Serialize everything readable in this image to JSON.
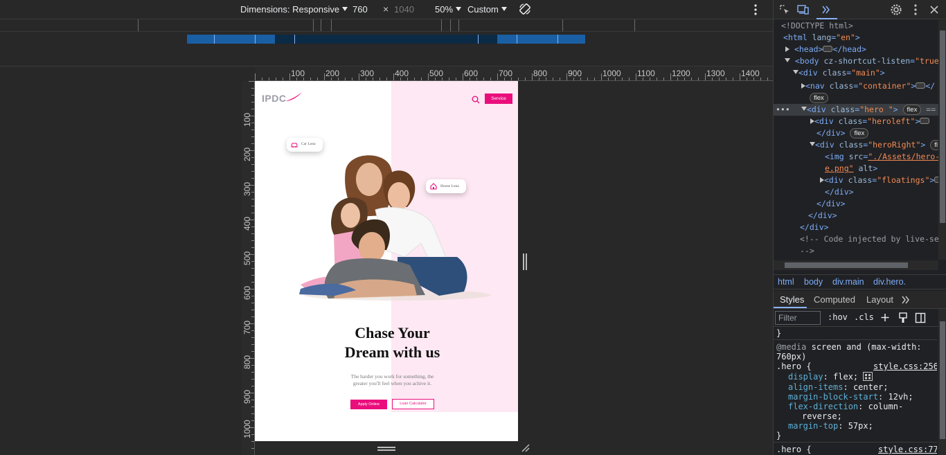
{
  "toolbar": {
    "dimensions_label": "Dimensions: Responsive",
    "width_value": "760",
    "times": "×",
    "height_value": "1040",
    "zoom_label": "50%",
    "throttle_label": "Custom"
  },
  "ruler_h": [
    "100",
    "200",
    "300",
    "400",
    "500",
    "600",
    "700",
    "800",
    "900",
    "1000",
    "1100",
    "1200",
    "1300",
    "1400"
  ],
  "ruler_v": [
    "100",
    "200",
    "300",
    "400",
    "500",
    "600",
    "700",
    "800",
    "900",
    "1000"
  ],
  "page": {
    "logo": "IPDC",
    "service_button": "Service",
    "badge_car": "Car Lona",
    "badge_house": "House Lona",
    "headline_line1": "Chase Your",
    "headline_line2": "Dream with us",
    "subtext_line1": "The harder you work for something, the",
    "subtext_line2": "greater you'll feel when you achive it.",
    "apply_button": "Apply Online",
    "calc_button": "Loan Calculator",
    "accent_color": "#ea0e7c",
    "pink_bg": "#fde8f3"
  },
  "elements": {
    "l1": "<!DOCTYPE html>",
    "l2_tag": "<html",
    "l2_attr": "lang",
    "l2_val": "\"en\"",
    "l3_open": "<head>",
    "l3_close": "</head>",
    "l4_tag": "<body",
    "l4_attr": "cz-shortcut-listen",
    "l4_val": "\"true\"",
    "l5_tag": "<div",
    "l5_attr": "class",
    "l5_val": "\"main\"",
    "l6_tag": "<nav",
    "l6_attr": "class",
    "l6_val": "\"container\"",
    "l6_close": "</",
    "pill_flex": "flex",
    "l8_tag": "<div",
    "l8_attr": "class",
    "l8_val": "\"hero \"",
    "l8_eq": "==",
    "l9_tag": "<div",
    "l9_attr": "class",
    "l9_val": "\"heroleft\"",
    "l10_close": "</div>",
    "l11_tag": "<div",
    "l11_attr": "class",
    "l11_val": "\"heroRight\"",
    "l11_pill": "fl",
    "l12_tag": "<img",
    "l12_attr": "src",
    "l12_val": "\"./Assets/hero-",
    "l13_val": "e.png\"",
    "l13_attr": "alt",
    "l14_tag": "<div",
    "l14_attr": "class",
    "l14_val": "\"floatings\"",
    "l15_close": "</div>",
    "l16_close": "</div>",
    "l17_close": "</div>",
    "l18_close": "</div>",
    "l19_comment": "<!-- Code injected by live-ser",
    "l20_comment": "-->"
  },
  "crumbs": [
    "html",
    "body",
    "div.main",
    "div.hero."
  ],
  "style_tabs": [
    "Styles",
    "Computed",
    "Layout"
  ],
  "filter_placeholder": "Filter",
  "hov": ":hov",
  "cls": ".cls",
  "css": {
    "close_brace": "}",
    "media": "@media",
    "media_rest": "screen and (max-width:",
    "media_rest2": "760px)",
    "selector": ".hero {",
    "source": "style.css:256",
    "p1": "display",
    "v1": "flex;",
    "p2": "align-items",
    "v2": "center;",
    "p3": "margin-block-start",
    "v3": "12vh;",
    "p4": "flex-direction",
    "v4": "column-",
    "v4b": "reverse;",
    "p5": "margin-top",
    "v5": "57px;",
    "end": "}",
    "selector2": ".hero {",
    "source2": "style.css:77"
  }
}
